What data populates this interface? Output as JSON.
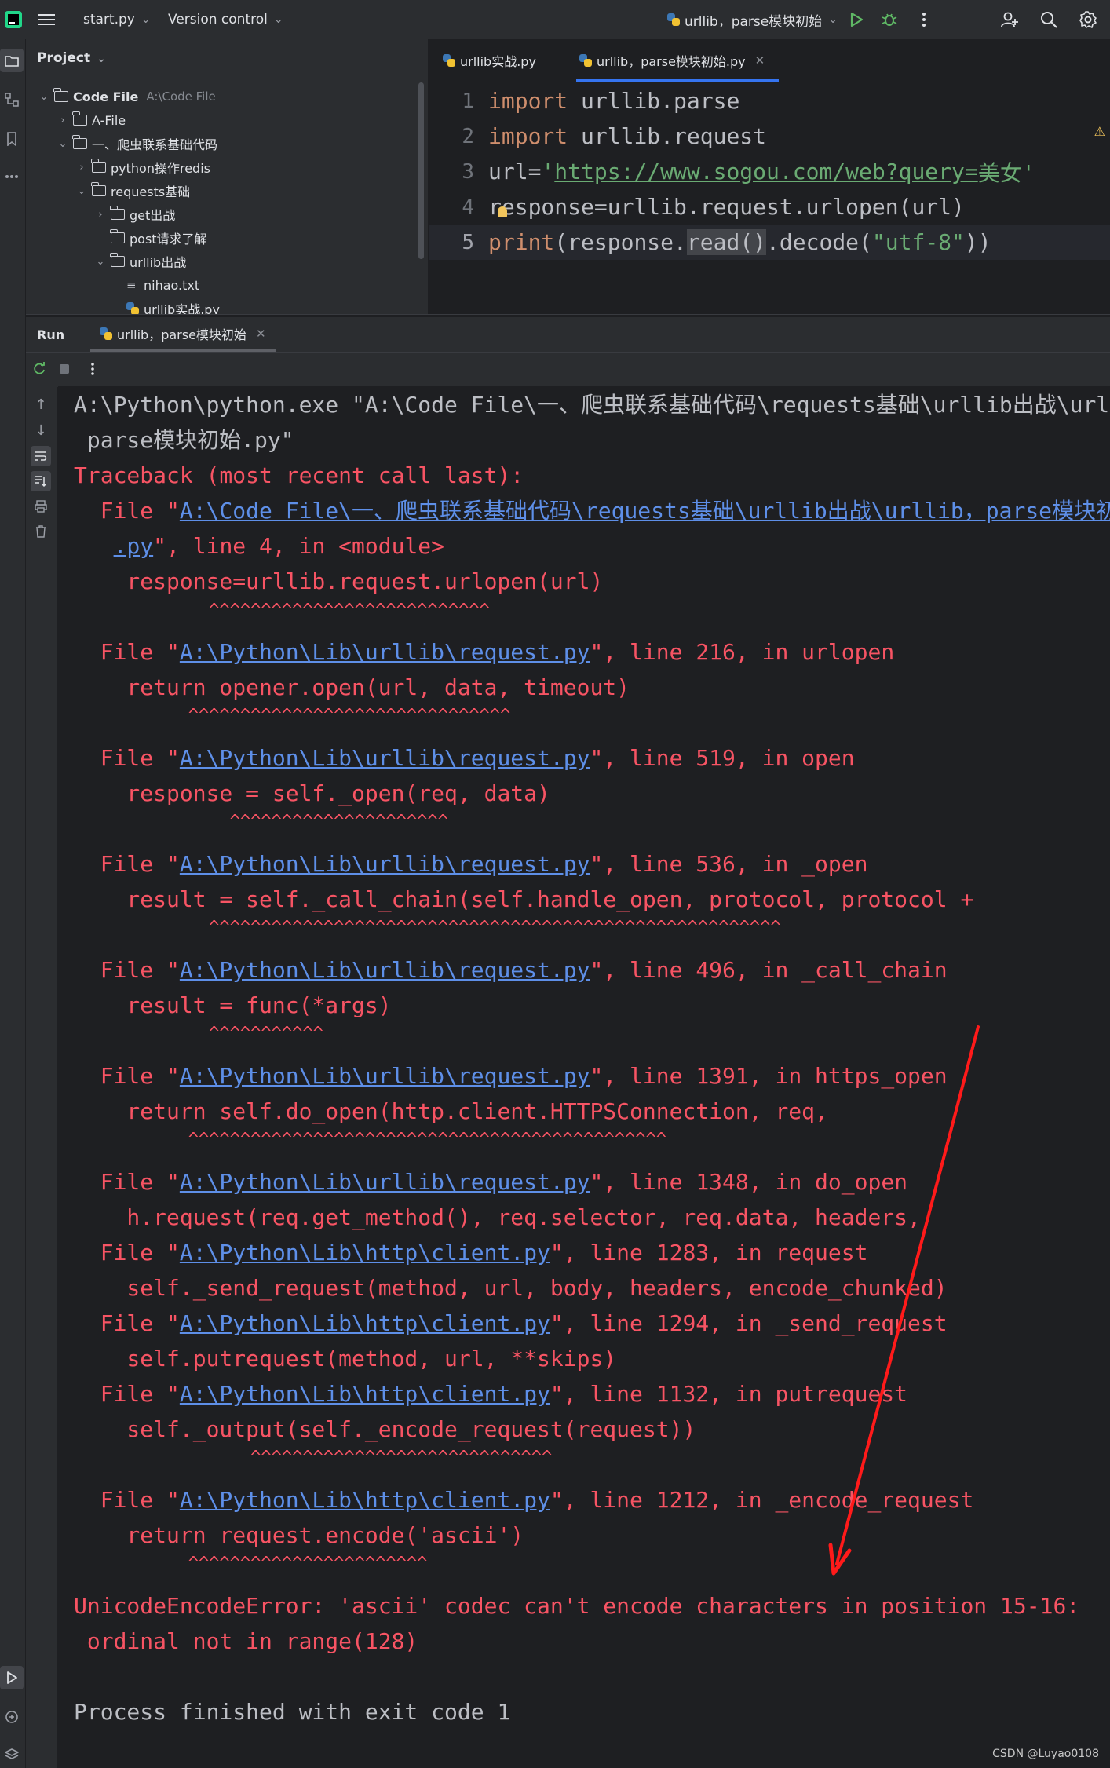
{
  "titlebar": {
    "file_menu": "start.py",
    "vcs_menu": "Version control",
    "run_config": "urllib，parse模块初始"
  },
  "project": {
    "header": "Project",
    "tree": [
      {
        "label": "Code File",
        "hint": "A:\\Code File"
      },
      {
        "label": "A-File"
      },
      {
        "label": "一、爬虫联系基础代码"
      },
      {
        "label": "python操作redis"
      },
      {
        "label": "requests基础"
      },
      {
        "label": "get出战"
      },
      {
        "label": "post请求了解"
      },
      {
        "label": "urllib出战"
      },
      {
        "label": "nihao.txt"
      },
      {
        "label": "urllib实战.py"
      }
    ]
  },
  "editor": {
    "tabs": [
      {
        "label": "urllib实战.py"
      },
      {
        "label": "urllib，parse模块初始.py"
      }
    ],
    "line_numbers": [
      "1",
      "2",
      "3",
      "4",
      "5"
    ],
    "code": {
      "l1_kw": "import",
      "l1_rest": " urllib.parse",
      "l2_kw": "import",
      "l2_rest": " urllib.request",
      "l3_a": "url=",
      "l3_q1": "'",
      "l3_url": "https://www.sogou.com/web?query=",
      "l3_tail": "美女'",
      "l4": "response=urllib.request.urlopen(url)",
      "l5_print": "print",
      "l5_a": "(response.",
      "l5_read": "read",
      "l5_paren": "()",
      "l5_b": ".decode(",
      "l5_str": "\"utf-8\"",
      "l5_c": "))"
    }
  },
  "run": {
    "tab_run": "Run",
    "tab_config": "urllib，parse模块初始"
  },
  "console": {
    "cmd1": "A:\\Python\\python.exe \"A:\\Code File\\一、爬虫联系基础代码\\requests基础\\urllib出战\\urllib，",
    "cmd2": " parse模块初始.py\"",
    "traceback": "Traceback (most recent call last):",
    "f1_pre": "  File \"",
    "f1_link": "A:\\Code File\\一、爬虫联系基础代码\\requests基础\\urllib出战\\urllib，parse模块初",
    "f1b_pre": "   ",
    "f1b_link": ".py",
    "f1b_post": "\", line 4, in <module>",
    "f1_code": "    response=urllib.request.urlopen(url)",
    "f1_carets": "             ^^^^^^^^^^^^^^^^^^^^^^^^^^^",
    "f2_link": "A:\\Python\\Lib\\urllib\\request.py",
    "f2_post": "\", line 216, in urlopen",
    "f2_code": "    return opener.open(url, data, timeout)",
    "f2_carets": "           ^^^^^^^^^^^^^^^^^^^^^^^^^^^^^^^",
    "f3_link": "A:\\Python\\Lib\\urllib\\request.py",
    "f3_post": "\", line 519, in open",
    "f3_code": "    response = self._open(req, data)",
    "f3_carets": "               ^^^^^^^^^^^^^^^^^^^^^",
    "f4_link": "A:\\Python\\Lib\\urllib\\request.py",
    "f4_post": "\", line 536, in _open",
    "f4_code": "    result = self._call_chain(self.handle_open, protocol, protocol +",
    "f4_carets": "             ^^^^^^^^^^^^^^^^^^^^^^^^^^^^^^^^^^^^^^^^^^^^^^^^^^^^^^^",
    "f5_link": "A:\\Python\\Lib\\urllib\\request.py",
    "f5_post": "\", line 496, in _call_chain",
    "f5_code": "    result = func(*args)",
    "f5_carets": "             ^^^^^^^^^^^",
    "f6_link": "A:\\Python\\Lib\\urllib\\request.py",
    "f6_post": "\", line 1391, in https_open",
    "f6_code": "    return self.do_open(http.client.HTTPSConnection, req,",
    "f6_carets": "           ^^^^^^^^^^^^^^^^^^^^^^^^^^^^^^^^^^^^^^^^^^^^^^",
    "f7_link": "A:\\Python\\Lib\\urllib\\request.py",
    "f7_post": "\", line 1348, in do_open",
    "f7_code": "    h.request(req.get_method(), req.selector, req.data, headers,",
    "f8_link": "A:\\Python\\Lib\\http\\client.py",
    "f8_post": "\", line 1283, in request",
    "f8_code": "    self._send_request(method, url, body, headers, encode_chunked)",
    "f9_link": "A:\\Python\\Lib\\http\\client.py",
    "f9_post": "\", line 1294, in _send_request",
    "f9_code": "    self.putrequest(method, url, **skips)",
    "f10_link": "A:\\Python\\Lib\\http\\client.py",
    "f10_post": "\", line 1132, in putrequest",
    "f10_code": "    self._output(self._encode_request(request))",
    "f10_carets": "                 ^^^^^^^^^^^^^^^^^^^^^^^^^^^^^",
    "f11_link": "A:\\Python\\Lib\\http\\client.py",
    "f11_post": "\", line 1212, in _encode_request",
    "f11_code": "    return request.encode('ascii')",
    "f11_carets": "           ^^^^^^^^^^^^^^^^^^^^^^^",
    "error1": "UnicodeEncodeError: 'ascii' codec can't encode characters in position 15-16:",
    "error2": " ordinal not in range(128)",
    "exit": "Process finished with exit code 1"
  },
  "watermark": "CSDN @Luyao0108",
  "colors": {
    "background": "#1e1f22",
    "panel": "#2b2d30",
    "error_text": "#f75464",
    "link": "#5e8fe8",
    "keyword": "#cf8e6d",
    "string": "#6aab73",
    "function": "#56a8f5",
    "annotation_arrow": "#ff1a1a",
    "accent": "#3574f0"
  }
}
